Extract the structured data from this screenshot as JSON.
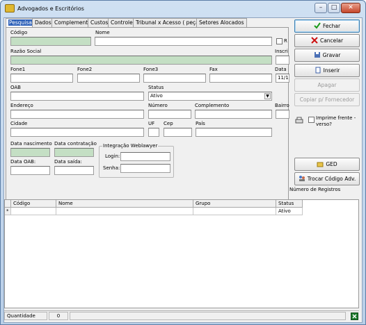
{
  "window": {
    "title": "Advogados e Escritórios",
    "minimize": "–",
    "maximize": "□",
    "close": "✕"
  },
  "tabs": [
    "Pesquisa",
    "Dados",
    "Complementos",
    "Custos",
    "Controle",
    "Tribunal x Acesso ( peças )",
    "Setores Alocados"
  ],
  "form": {
    "codigo_label": "Código",
    "nome_label": "Nome",
    "r_label": "R",
    "inscri_label": "Inscri",
    "razao_social_label": "Razão Social",
    "fone1_label": "Fone1",
    "fone2_label": "Fone2",
    "fone3_label": "Fone3",
    "fax_label": "Fax",
    "data_label": "Data",
    "data_value": "11/1(",
    "oab_label": "OAB",
    "status_label": "Status",
    "status_value": "Ativo",
    "endereco_label": "Endereço",
    "numero_label": "Número",
    "complemento_label": "Complemento",
    "bairro_label": "Bairro",
    "cidade_label": "Cidade",
    "uf_label": "UF",
    "cep_label": "Cep",
    "pais_label": "País",
    "data_nascimento_label": "Data nascimento",
    "data_contratacao_label": "Data contratação",
    "data_oab_label": "Data OAB:",
    "data_saida_label": "Data saída:",
    "integracao_title": "Integração Weblawyer",
    "login_label": "Login:",
    "senha_label": "Senha:"
  },
  "buttons": {
    "fechar": "Fechar",
    "cancelar": "Cancelar",
    "gravar": "Gravar",
    "inserir": "Inserir",
    "apagar": "Apagar",
    "copiar": "Copiar p/ Fornecedor",
    "imprime": "Imprime frente - verso?",
    "ged": "GED",
    "trocar": "Trocar Código Adv.",
    "numero_registros": "Número de Registros"
  },
  "grid": {
    "columns": [
      "Código",
      "Nome",
      "Grupo",
      "Status"
    ],
    "row_marker": "*",
    "rows": [
      [
        "",
        "",
        "",
        "Ativo"
      ]
    ]
  },
  "statusbar": {
    "quantidade_label": "Quantidade",
    "quantidade_value": "0"
  },
  "colors": {
    "readonly_green": "#c4dfc4",
    "fechar_green": "#1a9a1a",
    "cancelar_red": "#cc1111"
  }
}
